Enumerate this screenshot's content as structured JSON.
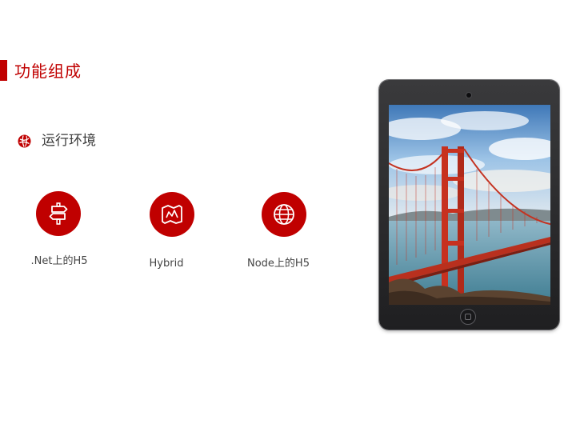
{
  "slide": {
    "title": "功能组成",
    "accent_color": "#c00000"
  },
  "section": {
    "label": "运行环境",
    "bullet_icon": "globe-bullet-icon"
  },
  "features": [
    {
      "label": ".Net上的H5",
      "icon": "signpost-icon"
    },
    {
      "label": "Hybrid",
      "icon": "map-icon"
    },
    {
      "label": "Node上的H5",
      "icon": "globe-icon"
    }
  ],
  "device": {
    "type": "tablet",
    "screen_image": "golden-gate-bridge-photo"
  }
}
